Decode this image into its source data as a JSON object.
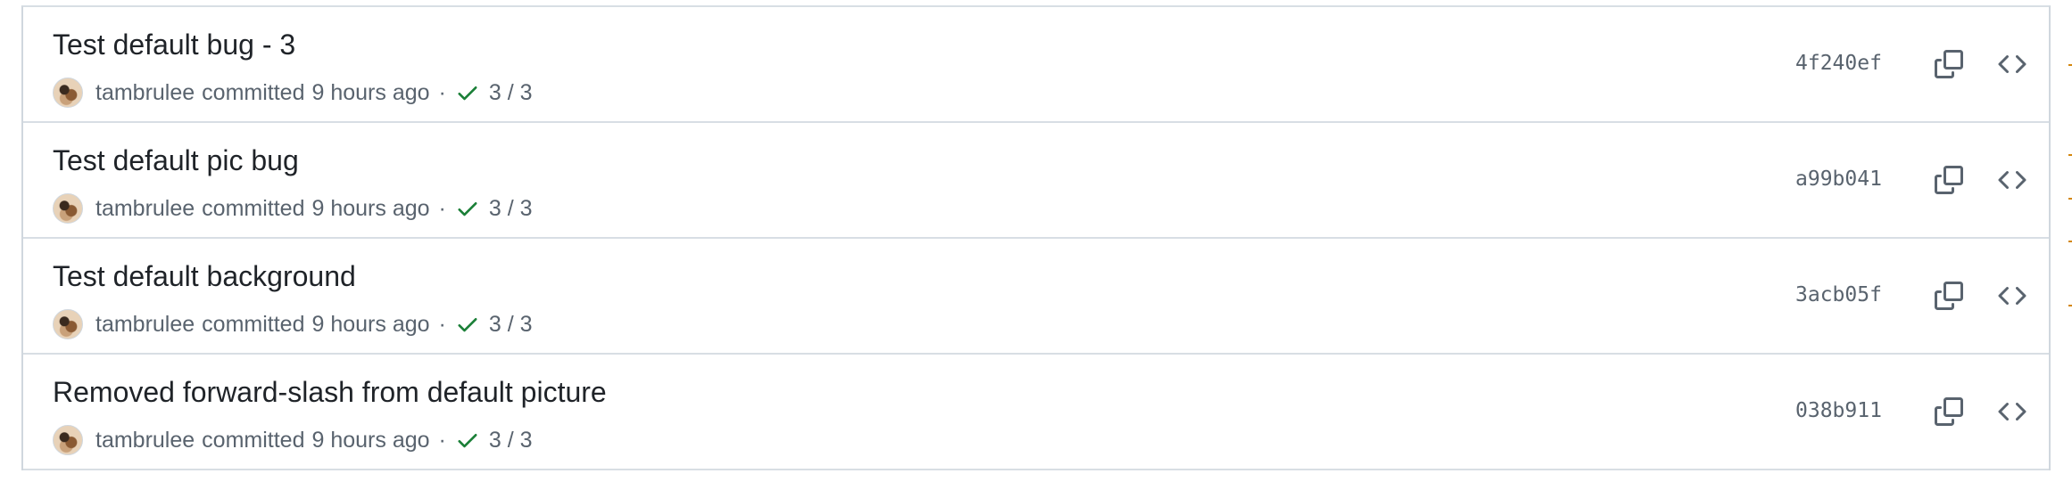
{
  "commits": [
    {
      "title": "Test default bug - 3",
      "author": "tambrulee",
      "action": "committed",
      "time": "9 hours ago",
      "separator": "·",
      "checks": "3 / 3",
      "sha": "4f240ef"
    },
    {
      "title": "Test default pic bug",
      "author": "tambrulee",
      "action": "committed",
      "time": "9 hours ago",
      "separator": "·",
      "checks": "3 / 3",
      "sha": "a99b041"
    },
    {
      "title": "Test default background",
      "author": "tambrulee",
      "action": "committed",
      "time": "9 hours ago",
      "separator": "·",
      "checks": "3 / 3",
      "sha": "3acb05f"
    },
    {
      "title": "Removed forward-slash from default picture",
      "author": "tambrulee",
      "action": "committed",
      "time": "9 hours ago",
      "separator": "·",
      "checks": "3 / 3",
      "sha": "038b911"
    }
  ],
  "icons": {
    "check": "check-icon",
    "copy": "copy-icon",
    "browse": "code-icon",
    "avatar": "avatar"
  },
  "colors": {
    "check_success": "#1a7f37",
    "text_primary": "#1f2328",
    "text_muted": "#59636e",
    "border": "#d8dee4",
    "graph_accent": "#d4870f"
  }
}
